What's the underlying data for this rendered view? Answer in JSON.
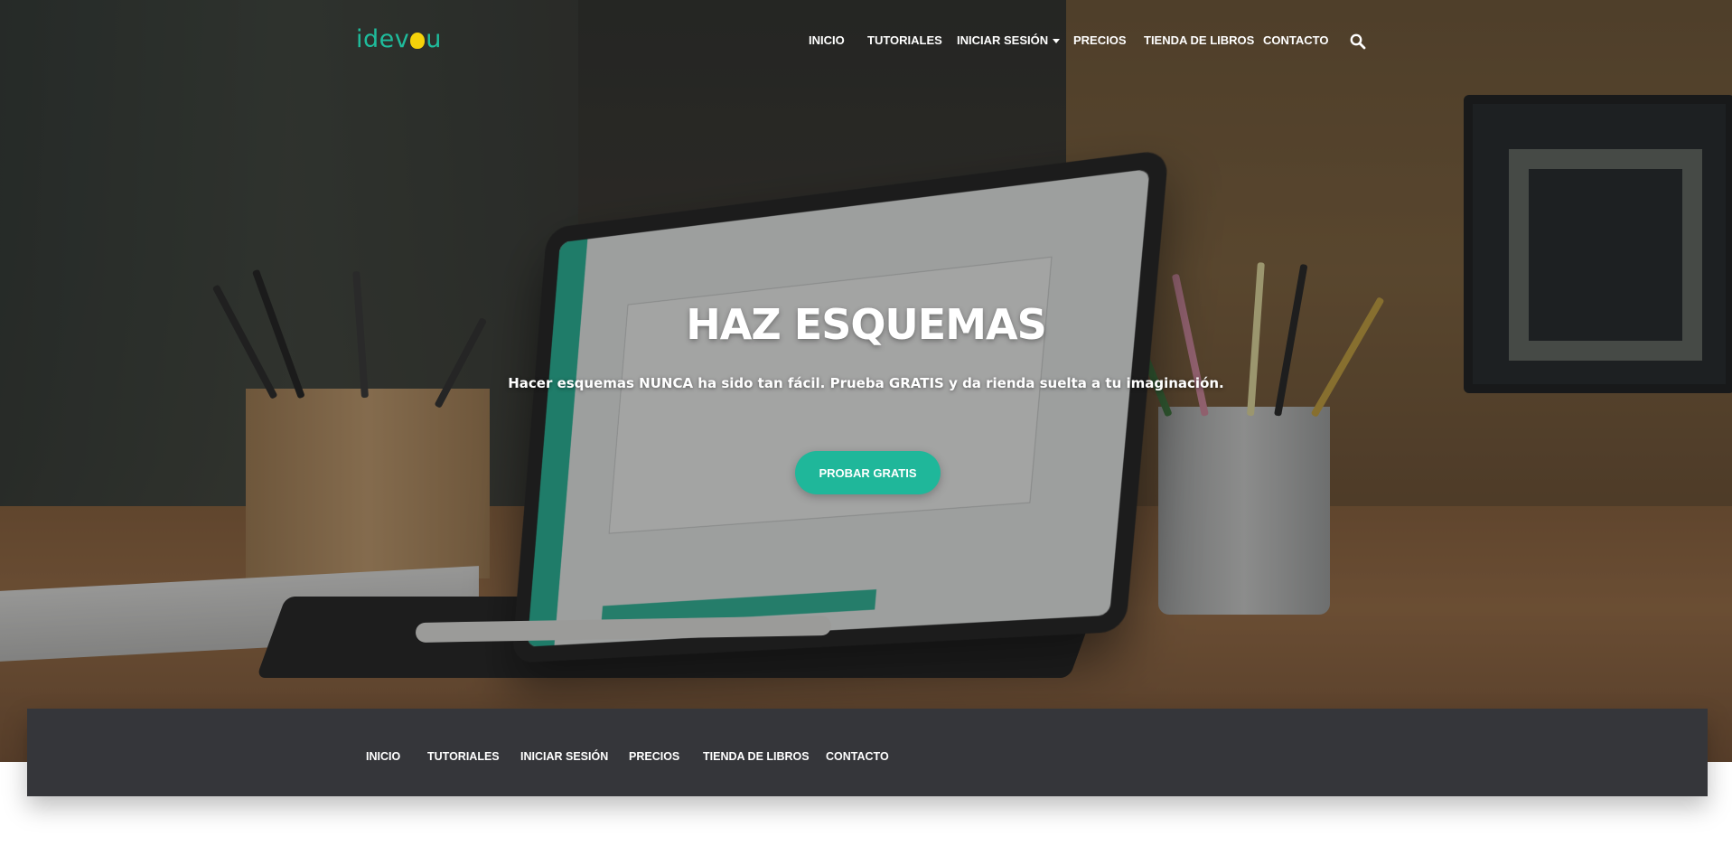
{
  "header": {
    "logo_text_left": "idev",
    "logo_text_right": "u",
    "nav": [
      {
        "label": "INICIO"
      },
      {
        "label": "TUTORIALES"
      },
      {
        "label": "INICIAR SESIÓN",
        "has_dropdown": true
      },
      {
        "label": "PRECIOS"
      },
      {
        "label": "TIENDA DE LIBROS"
      },
      {
        "label": "CONTACTO"
      }
    ],
    "search_icon": "search-icon"
  },
  "hero": {
    "title": "HAZ ESQUEMAS",
    "subtitle": "Hacer esquemas NUNCA ha sido tan fácil. Prueba GRATIS y da rienda suelta a tu imaginación.",
    "cta_label": "PROBAR GRATIS"
  },
  "subnav": {
    "items": [
      {
        "label": "INICIO"
      },
      {
        "label": "TUTORIALES"
      },
      {
        "label": "INICIAR SESIÓN"
      },
      {
        "label": "PRECIOS"
      },
      {
        "label": "TIENDA DE LIBROS"
      },
      {
        "label": "CONTACTO"
      }
    ]
  },
  "colors": {
    "accent": "#1fb79a",
    "logo_bulb": "#f5d20a",
    "subbar_bg": "#35363a"
  }
}
